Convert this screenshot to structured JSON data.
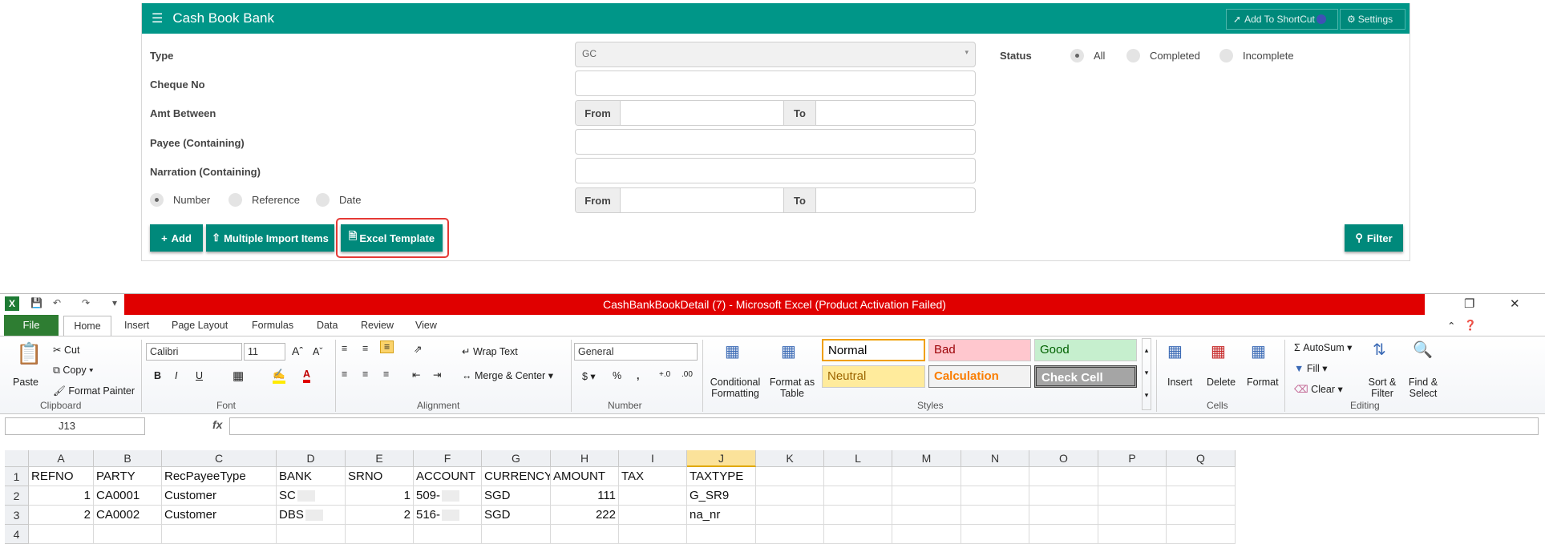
{
  "app": {
    "title": "Cash Book Bank",
    "shortcut_label": "Add To ShortCut",
    "settings_label": "Settings",
    "form": {
      "type_label": "Type",
      "type_value": "GC",
      "cheque_label": "Cheque No",
      "amt_label": "Amt Between",
      "payee_label": "Payee (Containing)",
      "narration_label": "Narration (Containing)",
      "from_label": "From",
      "to_label": "To",
      "sort_options": [
        "Number",
        "Reference",
        "Date"
      ],
      "sort_selected": "Number"
    },
    "status": {
      "label": "Status",
      "options": [
        "All",
        "Completed",
        "Incomplete"
      ],
      "selected": "All"
    },
    "buttons": {
      "add": "Add",
      "multiple_import": "Multiple Import Items",
      "excel_template": "Excel Template",
      "filter": "Filter"
    },
    "colors": {
      "header": "#009688",
      "button": "#00897b",
      "highlight": "#e53935"
    }
  },
  "excel": {
    "title": "CashBankBookDetail (7) - Microsoft Excel (Product Activation Failed)",
    "tabs": [
      "File",
      "Home",
      "Insert",
      "Page Layout",
      "Formulas",
      "Data",
      "Review",
      "View"
    ],
    "ribbon": {
      "clipboard": {
        "paste": "Paste",
        "cut": "Cut",
        "copy": "Copy",
        "format_painter": "Format Painter",
        "group": "Clipboard"
      },
      "font": {
        "name": "Calibri",
        "size": "11",
        "group": "Font"
      },
      "alignment": {
        "wrap_text": "Wrap Text",
        "merge_center": "Merge & Center",
        "group": "Alignment"
      },
      "number": {
        "format": "General",
        "group": "Number"
      },
      "styles": {
        "conditional": "Conditional Formatting",
        "format_table": "Format as Table",
        "cells": [
          "Normal",
          "Bad",
          "Good",
          "Neutral",
          "Calculation",
          "Check Cell"
        ],
        "group": "Styles"
      },
      "cells": {
        "insert": "Insert",
        "delete": "Delete",
        "format": "Format",
        "group": "Cells"
      },
      "editing": {
        "autosum": "AutoSum",
        "fill": "Fill",
        "clear": "Clear",
        "sort_filter": "Sort & Filter",
        "find_select": "Find & Select",
        "group": "Editing"
      }
    },
    "name_box": "J13",
    "columns": [
      "A",
      "B",
      "C",
      "D",
      "E",
      "F",
      "G",
      "H",
      "I",
      "J",
      "K",
      "L",
      "M",
      "N",
      "O",
      "P",
      "Q"
    ],
    "rows": [
      [
        "REFNO",
        "PARTY",
        "RecPayeeType",
        "BANK",
        "SRNO",
        "ACCOUNT",
        "CURRENCY",
        "AMOUNT",
        "TAX",
        "TAXTYPE"
      ],
      [
        "1",
        "CA0001",
        "Customer",
        "SC",
        "1",
        "509-",
        "SGD",
        "111",
        "",
        "G_SR9"
      ],
      [
        "2",
        "CA0002",
        "Customer",
        "DBS",
        "2",
        "516-",
        "SGD",
        "222",
        "",
        "na_nr"
      ]
    ]
  }
}
